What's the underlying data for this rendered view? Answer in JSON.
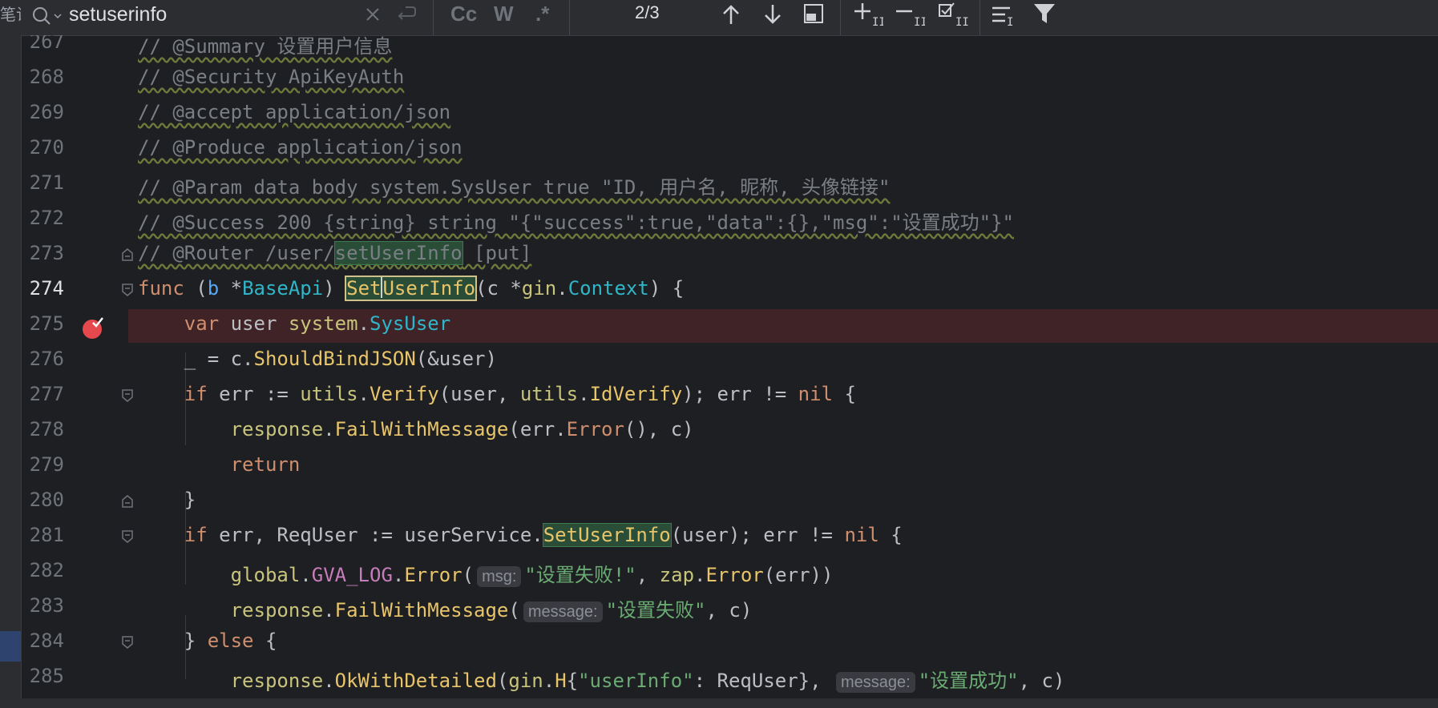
{
  "left_strip": {
    "fragment": "笔记"
  },
  "search": {
    "query": "setuserinfo",
    "options": {
      "case": "Cc",
      "words": "W",
      "regex": ".*"
    },
    "match_count": "2/3"
  },
  "icons": {
    "search": "magnifier-icon",
    "clear": "close-icon",
    "replace": "replace-icon",
    "prev": "arrow-up-icon",
    "next": "arrow-down-icon",
    "open_window": "window-icon",
    "add_occurrence": "add-occurrence-icon",
    "remove_occurrence": "remove-occurrence-icon",
    "select_all": "select-all-occurrences-icon",
    "filter_lines": "filter-lines-icon",
    "filter": "funnel-icon",
    "breakpoint": "breakpoint-icon",
    "fold": "fold-icon"
  },
  "editor": {
    "colors": {
      "background": "#1e1f22",
      "breakpoint_line": "#3f2327",
      "match_highlight": "#294d36",
      "keyword": "#cf8e6d",
      "string": "#6aab73",
      "function": "#56a8f5"
    },
    "lines": [
      {
        "n": "267"
      },
      {
        "n": "268"
      },
      {
        "n": "269"
      },
      {
        "n": "270"
      },
      {
        "n": "271"
      },
      {
        "n": "272"
      },
      {
        "n": "273"
      },
      {
        "n": "274"
      },
      {
        "n": "275"
      },
      {
        "n": "276"
      },
      {
        "n": "277"
      },
      {
        "n": "278"
      },
      {
        "n": "279"
      },
      {
        "n": "280"
      },
      {
        "n": "281"
      },
      {
        "n": "282"
      },
      {
        "n": "283"
      },
      {
        "n": "284"
      },
      {
        "n": "285"
      }
    ],
    "t": {
      "l267": "// @Summary 设置用户信息",
      "l268": "// @Security ApiKeyAuth",
      "l269": "// @accept application/json",
      "l270": "// @Produce application/json",
      "l271": "// @Param data body system.SysUser true \"ID, 用户名, 昵称, 头像链接\"",
      "l272": "// @Success 200 {string} string \"{\"success\":true,\"data\":{},\"msg\":\"设置成功\"}\"",
      "l273_a": "// @Router /user/",
      "l273_b": "setUserInfo",
      "l273_c": " [put]",
      "func": "func",
      "paren_o": " (",
      "b": "b",
      "star": " *",
      "baseapi": "BaseApi",
      "paren_c": ") ",
      "set_a": "Set",
      "set_b": "UserInfo",
      "args_a": "(c *",
      "gin": "gin",
      "dot": ".",
      "context": "Context",
      "args_b": ") {",
      "var": "var",
      "user_sp": " user ",
      "system": "system",
      "sysuser": "SysUser",
      "l276_a": "_ = c.",
      "shouldbind": "ShouldBindJSON",
      "l276_b": "(&user)",
      "if": "if",
      "l277_a": " err := ",
      "utils": "utils",
      "verify": "Verify",
      "l277_b": "(user, ",
      "idverify": "IdVerify",
      "l277_c": "); err != ",
      "nil": "nil",
      "brace_o": " {",
      "response": "response",
      "failwithmessage": "FailWithMessage",
      "l278_a": "(err.",
      "error": "Error",
      "l278_b": "(), c)",
      "return": "return",
      "brace_c": "}",
      "l281_a": " err, ReqUser := userService.",
      "setuserinfo_hit": "SetUserInfo",
      "l281_b": "(user); err != ",
      "global": "global",
      "gva_log": "GVA_LOG",
      "paren": "(",
      "hint_msg": "msg:",
      "str_fail1": "\"设置失败!\"",
      "comma": ", ",
      "zap": "zap",
      "l282_b": "(err))",
      "hint_message": "message:",
      "str_fail2": "\"设置失败\"",
      "c_close": ", c)",
      "l284_a": "} ",
      "else": "else",
      "okwithdetailed": "OkWithDetailed",
      "h": "H",
      "brace_o2": "{",
      "str_userinfo": "\"userInfo\"",
      "l285_b": ": ReqUser}, ",
      "str_ok": "\"设置成功\""
    }
  }
}
